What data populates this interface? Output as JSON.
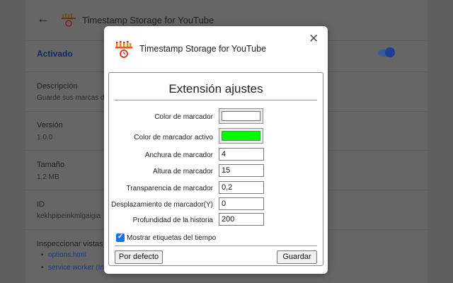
{
  "background": {
    "title": "Timestamp Storage for YouTube",
    "back_icon": "arrow-left-icon",
    "enabled_label": "Activado",
    "description_label": "Descripción",
    "description_value": "Guarde sus marcas d",
    "version_label": "Versión",
    "version_value": "1.0.0",
    "size_label": "Tamaño",
    "size_value": "1,2 MB",
    "id_label": "ID",
    "id_value": "kekhpipeinkmlgaigia",
    "inspect_label": "Inspeccionar vistas",
    "inspect_links": [
      "options.html",
      "service worker (In"
    ]
  },
  "modal": {
    "title": "Timestamp Storage for YouTube",
    "close_icon": "close-icon",
    "settings_title": "Extensión ajustes",
    "fields": [
      {
        "label": "Color de marcador",
        "type": "color",
        "value": "#ffffff"
      },
      {
        "label": "Color de marcador activo",
        "type": "color",
        "value": "#00ff00"
      },
      {
        "label": "Anchura de marcador",
        "type": "number",
        "value": "4"
      },
      {
        "label": "Altura de marcador",
        "type": "number",
        "value": "15"
      },
      {
        "label": "Transparencia de marcador",
        "type": "number",
        "value": "0,2"
      },
      {
        "label": "Desplazamiento de marcador(Y)",
        "type": "number",
        "value": "0"
      },
      {
        "label": "Profundidad de la historia",
        "type": "number",
        "value": "200"
      }
    ],
    "checkbox_label": "Mostrar etiquetas del tiempo",
    "checkbox_checked": true,
    "default_button": "Por defecto",
    "save_button": "Guardar"
  },
  "colors": {
    "accent": "#1a73e8",
    "active_marker": "#00ff00"
  }
}
